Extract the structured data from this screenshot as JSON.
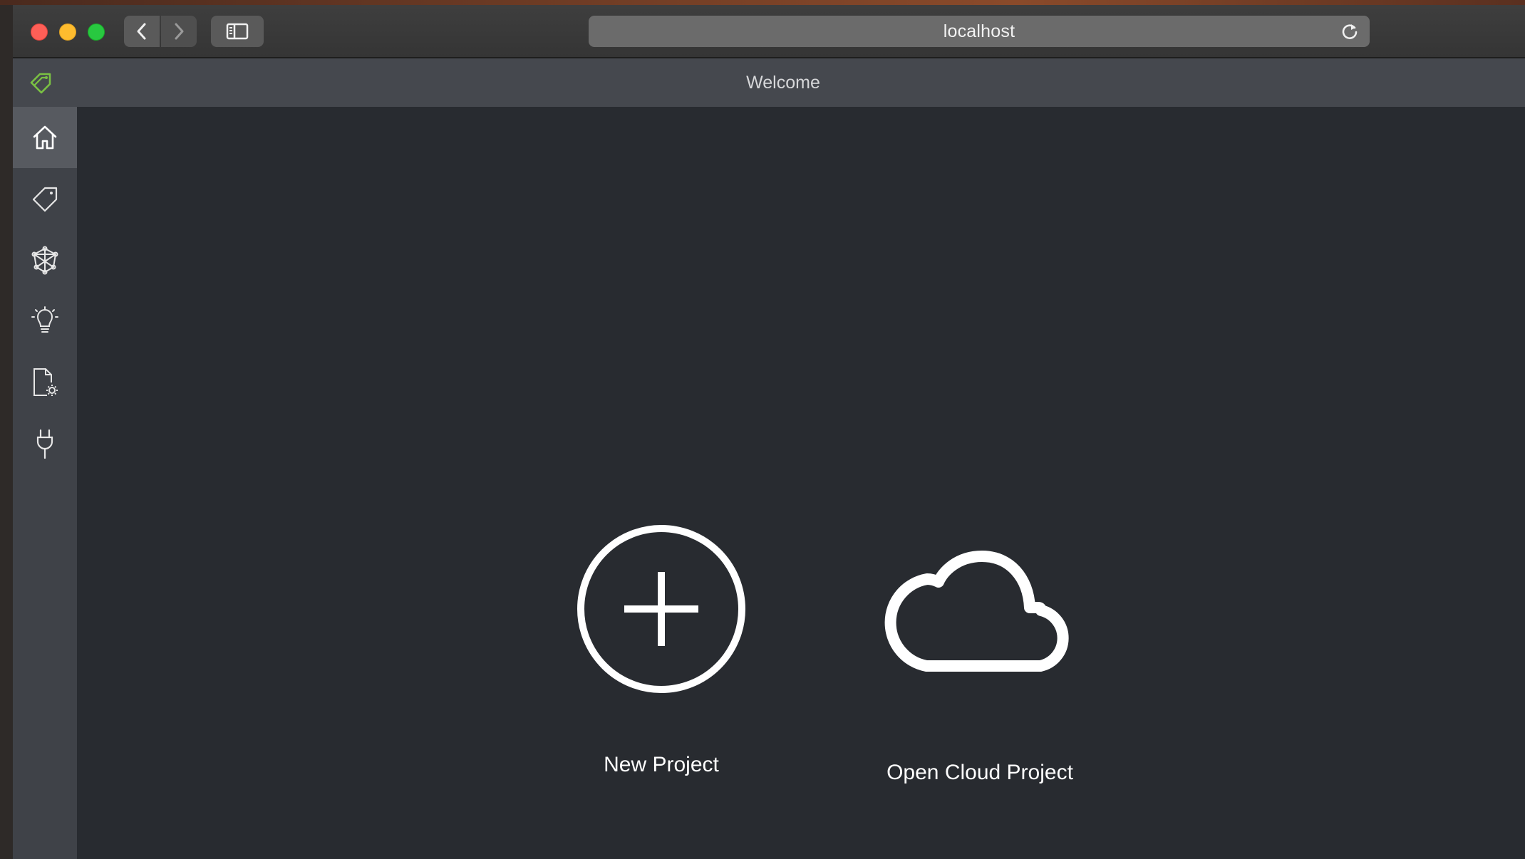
{
  "browser": {
    "url": "localhost",
    "back_icon": "chevron-left-icon",
    "forward_icon": "chevron-right-icon",
    "sidebar_icon": "sidebar-icon",
    "reload_icon": "reload-icon"
  },
  "app": {
    "title": "Welcome",
    "logo_icon": "tag-logo-icon",
    "accent_color": "#7ac143"
  },
  "side_nav": {
    "items": [
      {
        "name": "home",
        "icon": "home-icon",
        "active": true
      },
      {
        "name": "tags",
        "icon": "tag-icon",
        "active": false
      },
      {
        "name": "model",
        "icon": "network-icon",
        "active": false
      },
      {
        "name": "insights",
        "icon": "lightbulb-icon",
        "active": false
      },
      {
        "name": "export-settings",
        "icon": "document-gear-icon",
        "active": false
      },
      {
        "name": "connections",
        "icon": "plug-icon",
        "active": false
      }
    ]
  },
  "main": {
    "actions": [
      {
        "label": "New Project",
        "icon": "plus-circle-icon"
      },
      {
        "label": "Open Cloud Project",
        "icon": "cloud-icon"
      }
    ]
  }
}
